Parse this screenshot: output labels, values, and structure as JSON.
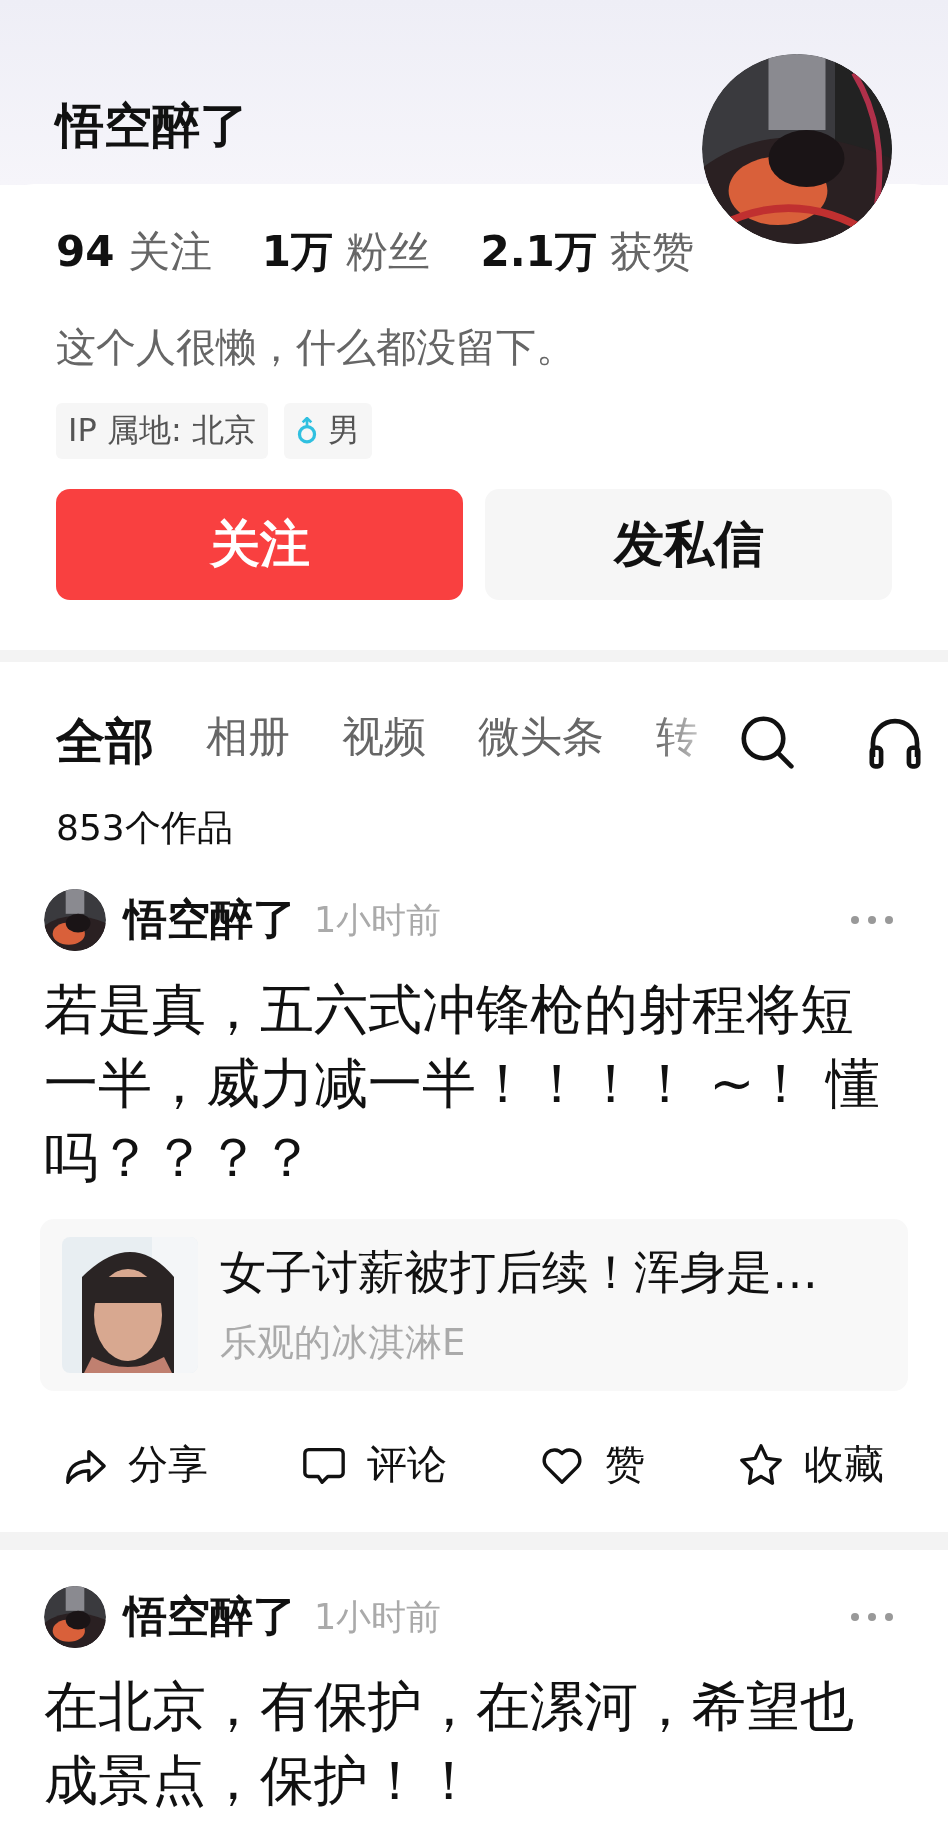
{
  "profile": {
    "name": "悟空醉了",
    "stats": [
      "**94** 关注",
      "**1万** 粉丝",
      "**2.1万** 获赞"
    ],
    "bio": "这个人很懒，什么都没留下。",
    "tags": [
      {
        "kind": "ip",
        "text": "IP 属地: 北京"
      },
      {
        "kind": "gender",
        "text": "男"
      }
    ],
    "buttons": [
      {
        "kind": "primary",
        "label": "关注"
      },
      {
        "kind": "secondary",
        "label": "发私信"
      }
    ]
  },
  "tabs": [
    {
      "label": "全部",
      "selected": true
    },
    {
      "label": "相册",
      "selected": false
    },
    {
      "label": "视频",
      "selected": false
    },
    {
      "label": "微头条",
      "selected": false
    },
    {
      "label": "转",
      "selected": false
    }
  ],
  "works_count": "853个作品",
  "posts": [
    {
      "author": "悟空醉了",
      "time": "1小时前",
      "text": "若是真，五六式冲锋枪的射程将短一半，威力减一半！！！！ ~！ 懂吗？？？？",
      "link": {
        "title": "女子讨薪被打后续！浑身是…",
        "source": "乐观的冰淇淋E"
      },
      "actions": [
        {
          "kind": "share",
          "label": "分享"
        },
        {
          "kind": "comment",
          "label": "评论"
        },
        {
          "kind": "like",
          "label": "赞"
        },
        {
          "kind": "favorite",
          "label": "收藏"
        }
      ]
    },
    {
      "author": "悟空醉了",
      "time": "1小时前",
      "text": "在北京，有保护，在漯河，希望也成景点，保护！！"
    }
  ]
}
